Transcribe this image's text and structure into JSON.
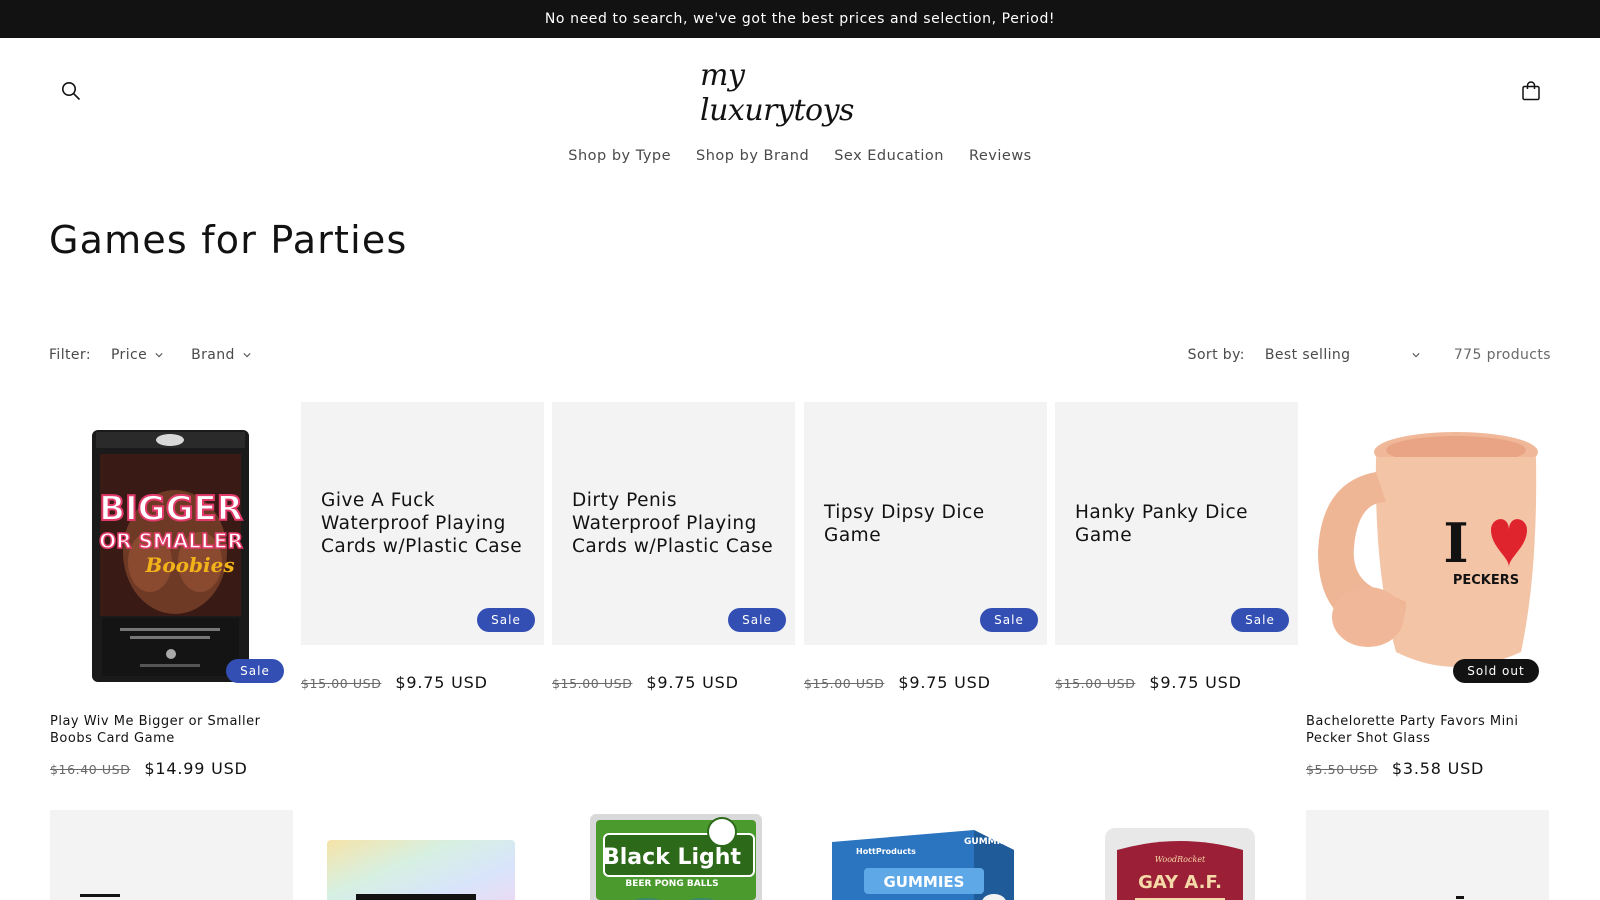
{
  "announcement": "No need to search, we've got the best prices and selection, Period!",
  "header": {
    "logo_text": "my luxurytoys"
  },
  "nav": [
    "Shop by Type",
    "Shop by Brand",
    "Sex Education",
    "Reviews"
  ],
  "collection": {
    "title": "Games for Parties",
    "filter_label": "Filter:",
    "filters": [
      "Price",
      "Brand"
    ],
    "sort_label": "Sort by:",
    "sort_value": "Best selling",
    "product_count": "775 products"
  },
  "products": [
    {
      "title": "Play Wiv Me Bigger or Smaller Boobs Card Game",
      "compare_price": "$16.40 USD",
      "price": "$14.99 USD",
      "badge": "Sale",
      "image": "box"
    },
    {
      "title": "Give A Fuck Waterproof Playing Cards w/Plastic Case",
      "compare_price": "$15.00 USD",
      "price": "$9.75 USD",
      "badge": "Sale",
      "image": "placeholder"
    },
    {
      "title": "Dirty Penis Waterproof Playing Cards w/Plastic Case",
      "compare_price": "$15.00 USD",
      "price": "$9.75 USD",
      "badge": "Sale",
      "image": "placeholder"
    },
    {
      "title": "Tipsy Dipsy Dice Game",
      "compare_price": "$15.00 USD",
      "price": "$9.75 USD",
      "badge": "Sale",
      "image": "placeholder"
    },
    {
      "title": "Hanky Panky Dice Game",
      "compare_price": "$15.00 USD",
      "price": "$9.75 USD",
      "badge": "Sale",
      "image": "placeholder"
    },
    {
      "title": "Bachelorette Party Favors Mini Pecker Shot Glass",
      "compare_price": "$5.50 USD",
      "price": "$3.58 USD",
      "badge": "Sold out",
      "image": "mug"
    }
  ],
  "box_art": {
    "line1": "BIGGER",
    "line2": "OR SMALLER",
    "line3": "Boobies"
  },
  "mug_art": {
    "letter": "I",
    "word": "PECKERS"
  },
  "row2_art": {
    "black_light": "Black Light",
    "beer_pong": "BEER PONG BALLS",
    "gummies": "GUMMIES",
    "gay": "GAY A.F."
  },
  "colors": {
    "sale_badge": "#334fb4",
    "sold_badge": "#121212",
    "announcement_bg": "#121212"
  }
}
